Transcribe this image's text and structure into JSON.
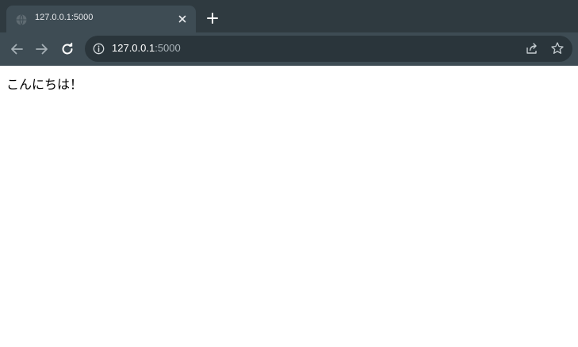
{
  "browser": {
    "tab": {
      "title": "127.0.0.1:5000",
      "favicon": "globe-icon",
      "close_icon": "close-icon"
    },
    "new_tab_icon": "plus-icon",
    "toolbar": {
      "back_icon": "arrow-left-icon",
      "forward_icon": "arrow-right-icon",
      "reload_icon": "reload-icon",
      "site_info_icon": "info-icon",
      "url_host": "127.0.0.1",
      "url_port": ":5000",
      "share_icon": "share-icon",
      "bookmark_icon": "star-icon"
    },
    "colors": {
      "tab_strip": "#2f3a40",
      "toolbar": "#3e4c54",
      "omnibox": "#2a353b",
      "page_background": "#ffffff"
    }
  },
  "page": {
    "body_text": "こんにちは！"
  }
}
